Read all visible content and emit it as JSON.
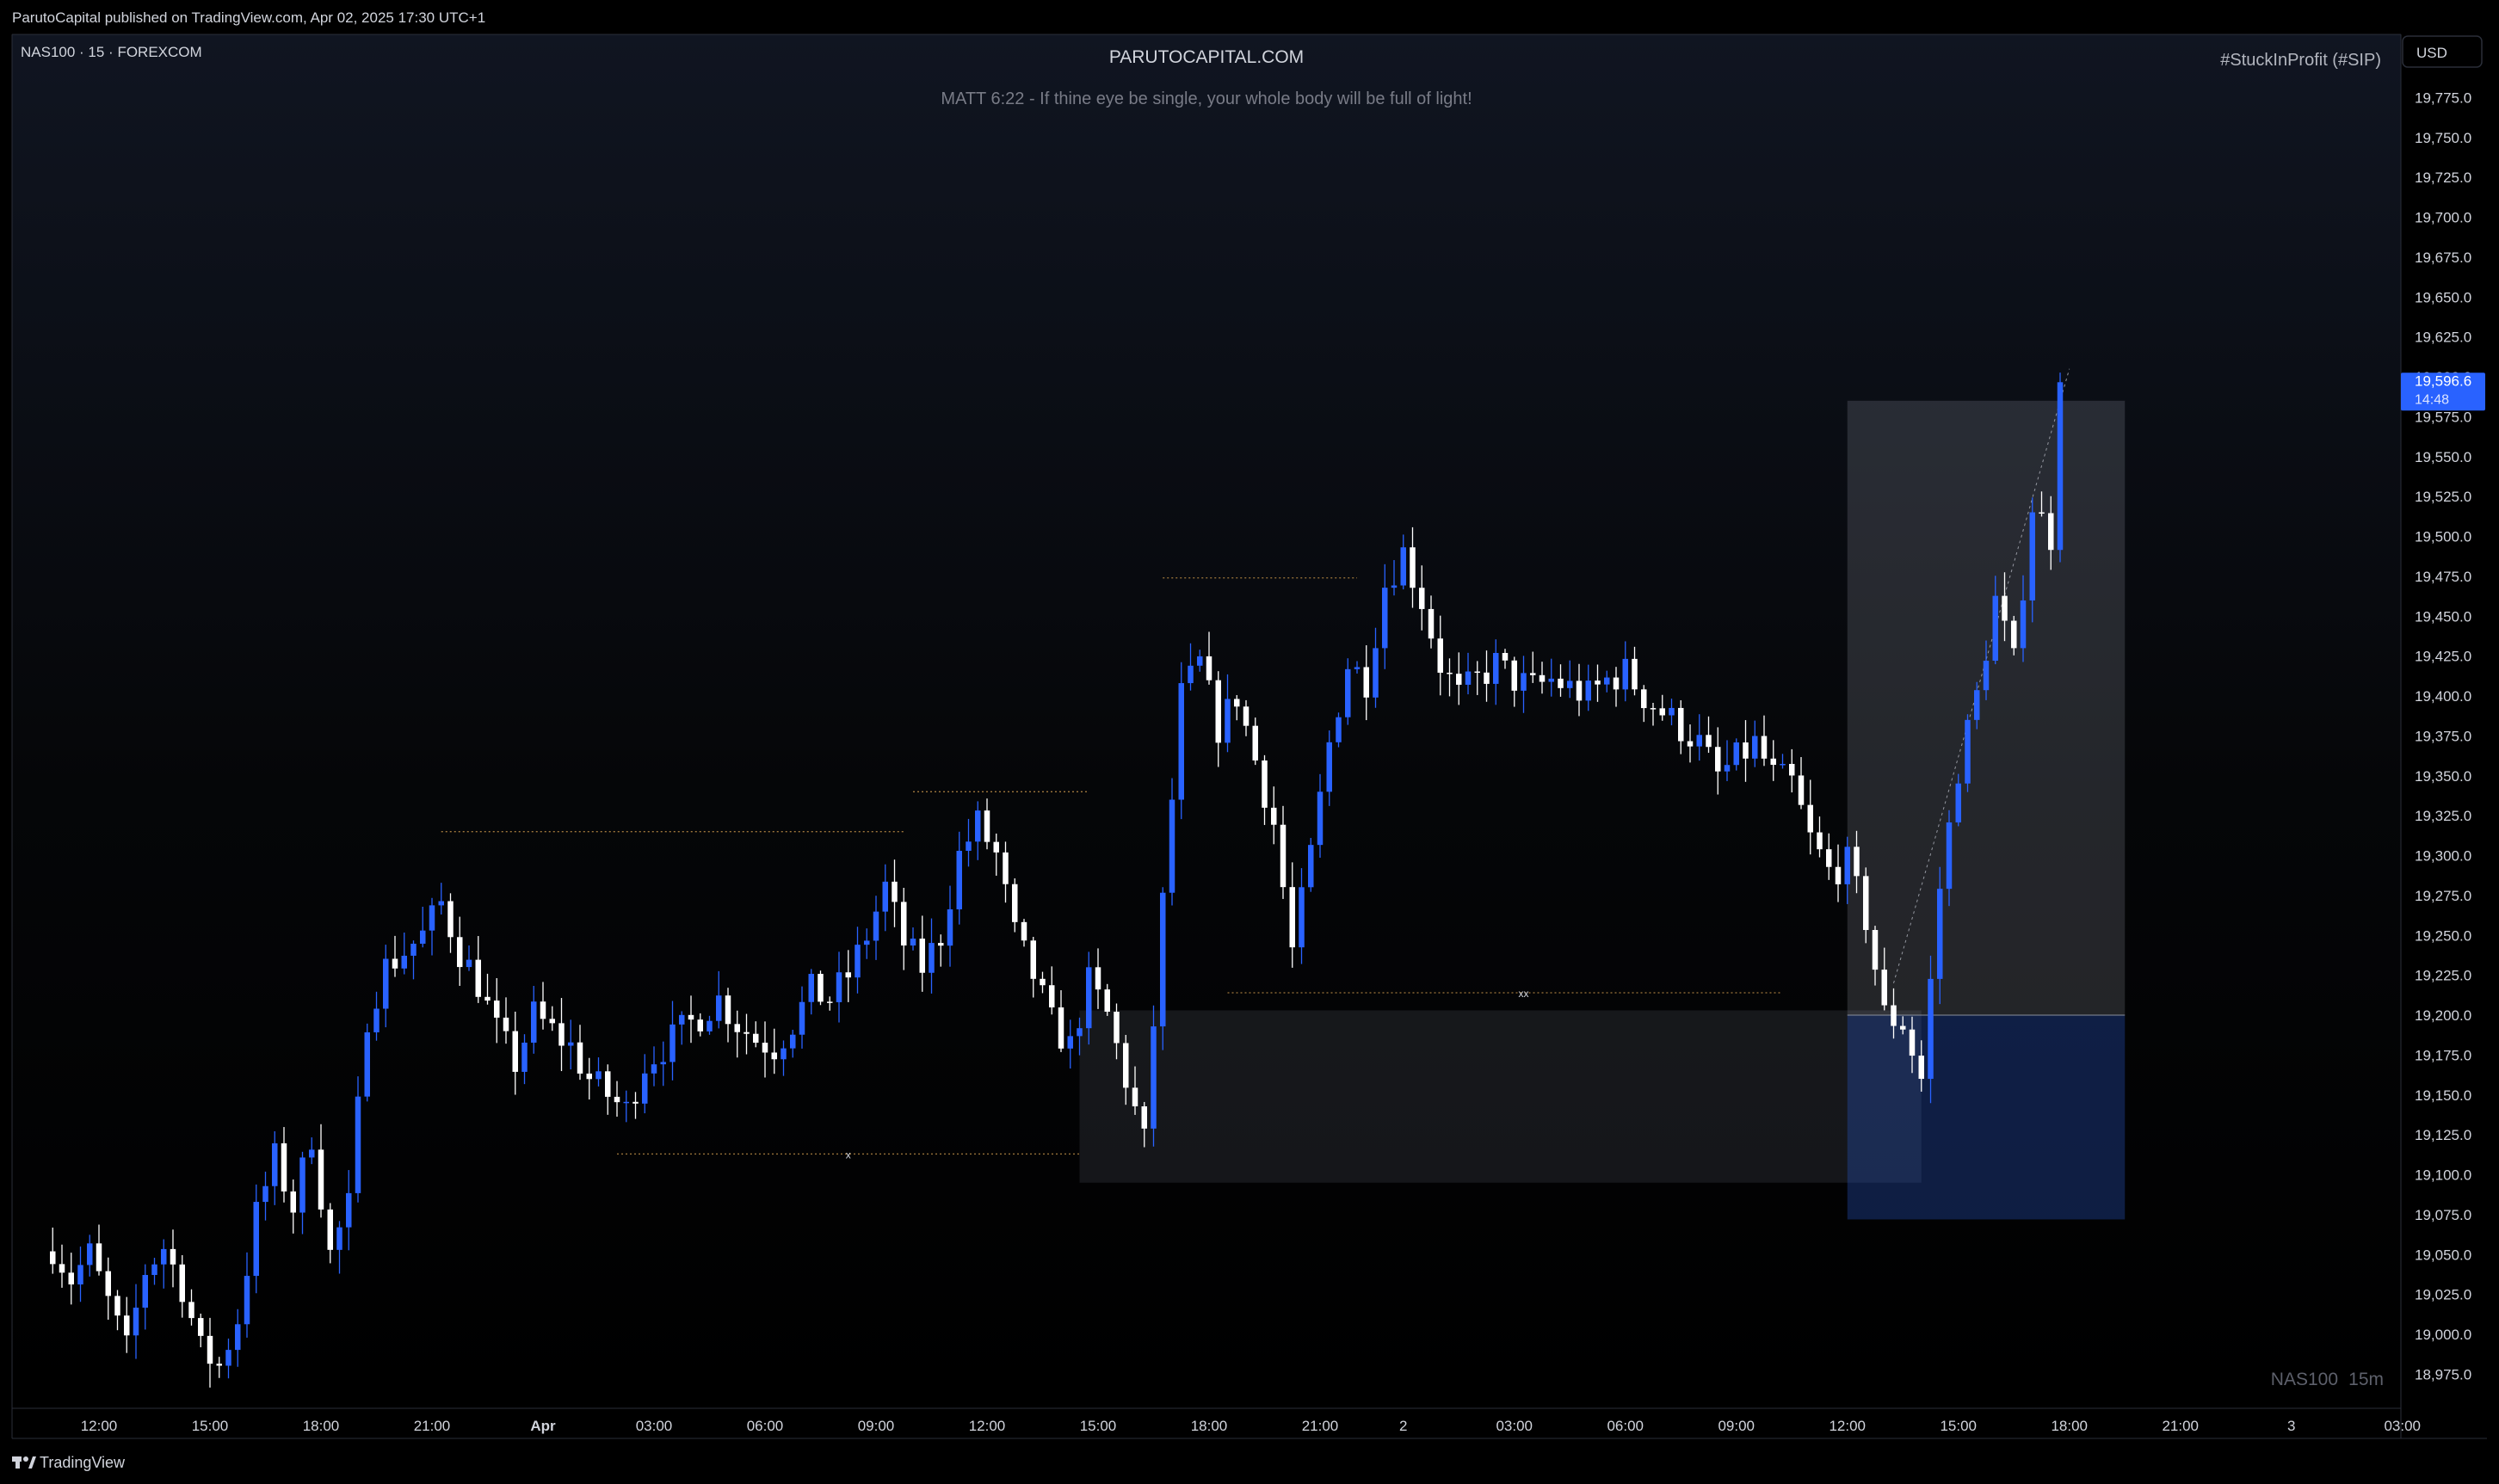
{
  "publisher_line": "ParutoCapital published on TradingView.com, Apr 02, 2025 17:30 UTC+1",
  "symbol_info": "NAS100 · 15 · FOREXCOM",
  "watermark_top": "PARUTOCAPITAL.COM",
  "subtitle": "MATT 6:22 - If thine eye be single, your whole body will be full of light!",
  "hashtag": "#StuckInProfit (#SIP)",
  "currency_button": "USD",
  "watermark_bottom": {
    "symbol": "NAS100",
    "interval": "15m"
  },
  "footer_brand": "TradingView",
  "colors": {
    "up": "#2962ff",
    "down": "#ffffff",
    "bg": "#000000",
    "accent": "#2962ff",
    "level": "#a0783c"
  },
  "last_price": {
    "value": "19,596.6",
    "countdown": "14:48"
  },
  "markers": [
    {
      "text": "x"
    },
    {
      "text": "xx"
    }
  ],
  "chart_data": {
    "type": "candlestick",
    "timeframe": "15m",
    "ylim": [
      18955,
      19795
    ],
    "y_ticks": [
      18975,
      19000,
      19025,
      19050,
      19075,
      19100,
      19125,
      19150,
      19175,
      19200,
      19225,
      19250,
      19275,
      19300,
      19325,
      19350,
      19375,
      19400,
      19425,
      19450,
      19475,
      19500,
      19525,
      19550,
      19575,
      19600,
      19625,
      19650,
      19675,
      19700,
      19725,
      19750,
      19775
    ],
    "y_tick_labels": [
      "18,975.0",
      "19,000.0",
      "19,025.0",
      "19,050.0",
      "19,075.0",
      "19,100.0",
      "19,125.0",
      "19,150.0",
      "19,175.0",
      "19,200.0",
      "19,225.0",
      "19,250.0",
      "19,275.0",
      "19,300.0",
      "19,325.0",
      "19,350.0",
      "19,375.0",
      "19,400.0",
      "19,425.0",
      "19,450.0",
      "19,475.0",
      "19,500.0",
      "19,525.0",
      "19,550.0",
      "19,575.0",
      "19,600.0",
      "19,625.0",
      "19,650.0",
      "19,675.0",
      "19,700.0",
      "19,725.0",
      "19,750.0",
      "19,775.0"
    ],
    "x_ticks": [
      {
        "label": "12:00",
        "t": 5
      },
      {
        "label": "15:00",
        "t": 17
      },
      {
        "label": "18:00",
        "t": 29
      },
      {
        "label": "21:00",
        "t": 41
      },
      {
        "label": "Apr",
        "t": 53,
        "bold": true
      },
      {
        "label": "03:00",
        "t": 65
      },
      {
        "label": "06:00",
        "t": 77
      },
      {
        "label": "09:00",
        "t": 89
      },
      {
        "label": "12:00",
        "t": 101
      },
      {
        "label": "15:00",
        "t": 113
      },
      {
        "label": "18:00",
        "t": 125
      },
      {
        "label": "21:00",
        "t": 137
      },
      {
        "label": "2",
        "t": 146
      },
      {
        "label": "03:00",
        "t": 158
      },
      {
        "label": "06:00",
        "t": 170
      },
      {
        "label": "09:00",
        "t": 182
      },
      {
        "label": "12:00",
        "t": 194
      },
      {
        "label": "15:00",
        "t": 206
      },
      {
        "label": "18:00",
        "t": 218
      },
      {
        "label": "21:00",
        "t": 230
      },
      {
        "label": "3",
        "t": 242
      },
      {
        "label": "03:00",
        "t": 254
      }
    ],
    "anchors": [
      [
        0,
        19055
      ],
      [
        2,
        19035
      ],
      [
        4,
        19050
      ],
      [
        6,
        19020
      ],
      [
        8,
        18990
      ],
      [
        10,
        19040
      ],
      [
        12,
        19055
      ],
      [
        14,
        19030
      ],
      [
        16,
        18990
      ],
      [
        18,
        18980
      ],
      [
        20,
        19010
      ],
      [
        22,
        19075
      ],
      [
        24,
        19110
      ],
      [
        26,
        19080
      ],
      [
        28,
        19125
      ],
      [
        30,
        19050
      ],
      [
        32,
        19080
      ],
      [
        34,
        19200
      ],
      [
        36,
        19230
      ],
      [
        38,
        19240
      ],
      [
        40,
        19250
      ],
      [
        42,
        19270
      ],
      [
        44,
        19240
      ],
      [
        46,
        19220
      ],
      [
        48,
        19190
      ],
      [
        50,
        19170
      ],
      [
        52,
        19200
      ],
      [
        54,
        19190
      ],
      [
        56,
        19180
      ],
      [
        58,
        19160
      ],
      [
        60,
        19150
      ],
      [
        62,
        19140
      ],
      [
        64,
        19170
      ],
      [
        66,
        19180
      ],
      [
        68,
        19190
      ],
      [
        70,
        19200
      ],
      [
        72,
        19210
      ],
      [
        74,
        19195
      ],
      [
        76,
        19185
      ],
      [
        78,
        19180
      ],
      [
        80,
        19195
      ],
      [
        82,
        19215
      ],
      [
        84,
        19210
      ],
      [
        86,
        19225
      ],
      [
        88,
        19250
      ],
      [
        90,
        19280
      ],
      [
        92,
        19245
      ],
      [
        94,
        19230
      ],
      [
        96,
        19250
      ],
      [
        98,
        19300
      ],
      [
        100,
        19320
      ],
      [
        102,
        19300
      ],
      [
        104,
        19250
      ],
      [
        106,
        19225
      ],
      [
        108,
        19195
      ],
      [
        110,
        19180
      ],
      [
        112,
        19220
      ],
      [
        114,
        19200
      ],
      [
        116,
        19160
      ],
      [
        118,
        19120
      ],
      [
        120,
        19270
      ],
      [
        122,
        19400
      ],
      [
        124,
        19420
      ],
      [
        126,
        19380
      ],
      [
        128,
        19400
      ],
      [
        130,
        19360
      ],
      [
        132,
        19320
      ],
      [
        134,
        19240
      ],
      [
        136,
        19300
      ],
      [
        138,
        19370
      ],
      [
        140,
        19420
      ],
      [
        142,
        19410
      ],
      [
        144,
        19470
      ],
      [
        146,
        19490
      ],
      [
        148,
        19460
      ],
      [
        150,
        19420
      ],
      [
        152,
        19400
      ],
      [
        154,
        19410
      ],
      [
        156,
        19420
      ],
      [
        158,
        19410
      ],
      [
        160,
        19405
      ],
      [
        162,
        19410
      ],
      [
        164,
        19405
      ],
      [
        166,
        19400
      ],
      [
        168,
        19410
      ],
      [
        170,
        19415
      ],
      [
        172,
        19400
      ],
      [
        174,
        19390
      ],
      [
        176,
        19380
      ],
      [
        178,
        19370
      ],
      [
        180,
        19350
      ],
      [
        182,
        19360
      ],
      [
        184,
        19370
      ],
      [
        186,
        19350
      ],
      [
        188,
        19345
      ],
      [
        190,
        19310
      ],
      [
        192,
        19290
      ],
      [
        194,
        19295
      ],
      [
        196,
        19260
      ],
      [
        198,
        19200
      ],
      [
        200,
        19195
      ],
      [
        202,
        19160
      ],
      [
        204,
        19280
      ],
      [
        206,
        19355
      ],
      [
        208,
        19400
      ],
      [
        210,
        19460
      ],
      [
        212,
        19420
      ],
      [
        214,
        19520
      ],
      [
        216,
        19500
      ],
      [
        217,
        19596.6
      ]
    ],
    "levels": [
      {
        "y": 19315,
        "t1": 42,
        "t2": 92
      },
      {
        "y": 19340,
        "t1": 93,
        "t2": 112
      },
      {
        "y": 19474,
        "t1": 120,
        "t2": 141
      },
      {
        "y": 19113,
        "t1": 61,
        "t2": 111
      },
      {
        "y": 19214,
        "t1": 127,
        "t2": 187
      }
    ],
    "zones": [
      {
        "type": "range",
        "y1": 19095,
        "y2": 19203,
        "t1": 111,
        "t2": 202
      },
      {
        "type": "profit",
        "y1": 19200,
        "y2": 19585,
        "t1": 194,
        "t2": 224
      },
      {
        "type": "stop",
        "y1": 19072,
        "y2": 19200,
        "t1": 194,
        "t2": 224
      }
    ],
    "last_price": 19596.6
  }
}
